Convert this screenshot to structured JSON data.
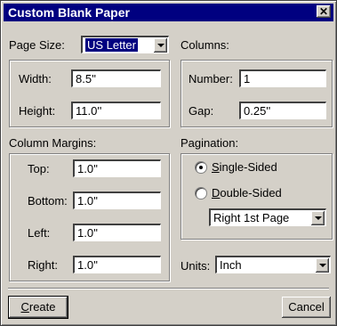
{
  "window": {
    "title": "Custom Blank Paper",
    "close_symbol": "✕"
  },
  "page_size": {
    "label": "Page Size:",
    "value": "US Letter"
  },
  "size": {
    "width_label": "Width:",
    "width_value": "8.5''",
    "height_label": "Height:",
    "height_value": "11.0''"
  },
  "columns": {
    "label": "Columns:",
    "number_label": "Number:",
    "number_value": "1",
    "gap_label": "Gap:",
    "gap_value": "0.25''"
  },
  "margins": {
    "label": "Column Margins:",
    "top_label": "Top:",
    "top_value": "1.0''",
    "bottom_label": "Bottom:",
    "bottom_value": "1.0''",
    "left_label": "Left:",
    "left_value": "1.0''",
    "right_label": "Right:",
    "right_value": "1.0''"
  },
  "pagination": {
    "label": "Pagination:",
    "single_first": "S",
    "single_rest": "ingle-Sided",
    "double_first": "D",
    "double_rest": "ouble-Sided",
    "selected": "single",
    "first_page_value": "Right 1st Page"
  },
  "units": {
    "label": "Units:",
    "value": "Inch"
  },
  "buttons": {
    "create_first": "C",
    "create_rest": "reate",
    "cancel": "Cancel"
  }
}
